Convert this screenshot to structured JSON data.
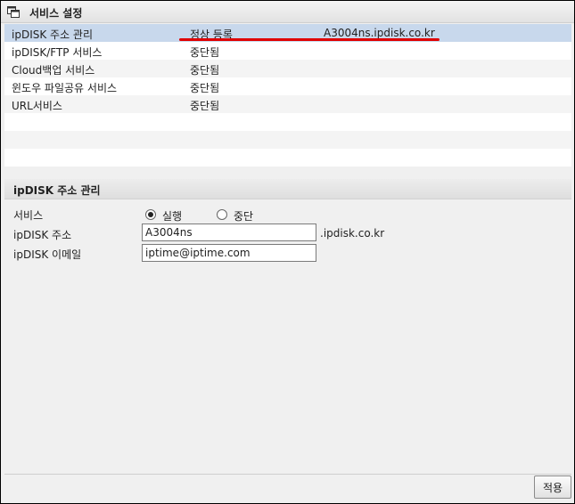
{
  "header": {
    "title": "서비스 설정",
    "icon": "window-restore-icon"
  },
  "services": [
    {
      "name": "ipDISK 주소 관리",
      "status": "정상 등록",
      "extra": "A3004ns.ipdisk.co.kr"
    },
    {
      "name": "ipDISK/FTP 서비스",
      "status": "중단됨",
      "extra": ""
    },
    {
      "name": "Cloud백업 서비스",
      "status": "중단됨",
      "extra": ""
    },
    {
      "name": "윈도우 파일공유 서비스",
      "status": "중단됨",
      "extra": ""
    },
    {
      "name": "URL서비스",
      "status": "중단됨",
      "extra": ""
    }
  ],
  "section": {
    "title": "ipDISK 주소 관리",
    "service_label": "서비스",
    "radio_run": "실행",
    "radio_stop": "중단",
    "selected_option": "실행",
    "address_label": "ipDISK 주소",
    "address_value": "A3004ns",
    "address_suffix": ".ipdisk.co.kr",
    "email_label": "ipDISK 이메일",
    "email_value": "iptime@iptime.com"
  },
  "footer": {
    "apply_label": "적용"
  },
  "colors": {
    "selected_row": "#c8d8ec",
    "highlight": "#e00000"
  }
}
